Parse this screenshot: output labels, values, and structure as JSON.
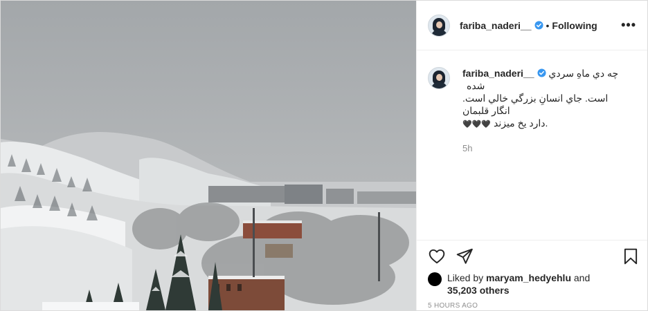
{
  "post": {
    "username": "fariba_naderi__",
    "follow_label": "Following",
    "separator": "•",
    "more_label": "•••"
  },
  "caption": {
    "username": "fariba_naderi__",
    "text_line1": "چه دي ماهِ سردي شده",
    "text_line2": "است. جاي انسانِ بزرگي خالي است. انگار قلبمان",
    "text_line3": "دارد يخ ميزند.",
    "hearts": "🖤🖤🖤",
    "time": "5h"
  },
  "engagement": {
    "liked_by_prefix": "Liked by",
    "liked_by_user": "maryam_hedyehlu",
    "and_label": "and",
    "others": "35,203 others",
    "age": "5 HOURS AGO"
  },
  "icons": {
    "more": "more-icon",
    "heart": "heart-icon",
    "share": "share-icon",
    "save": "bookmark-icon",
    "verified": "verified-badge-icon",
    "verified_color": "#3897f0"
  }
}
